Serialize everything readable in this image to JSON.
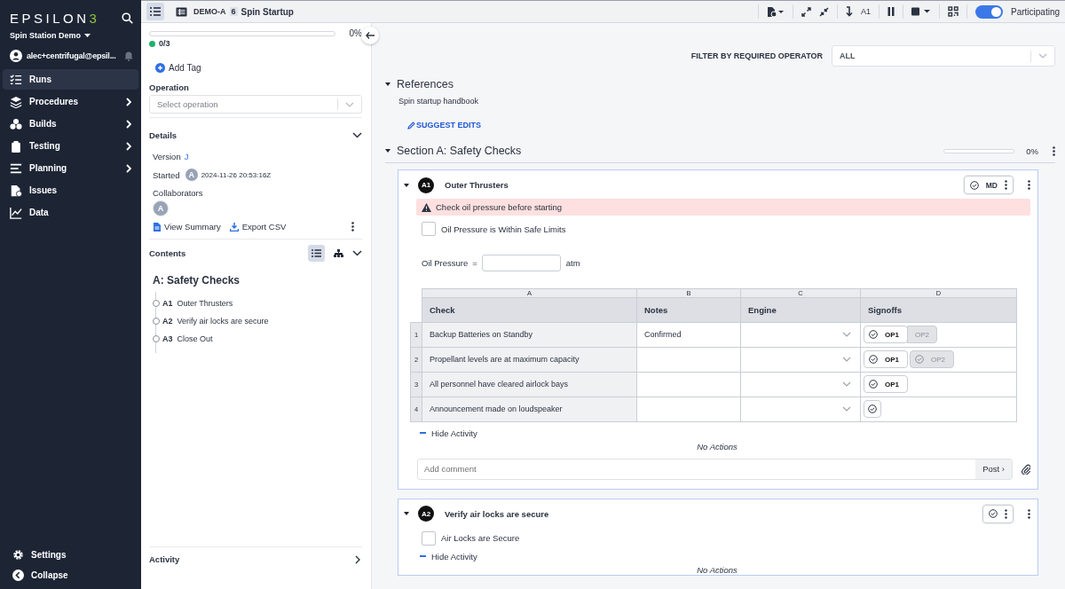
{
  "sidebar": {
    "logo": {
      "text": "EPSILON",
      "mark": "3"
    },
    "workspace": "Spin Station Demo",
    "user": "alec+centrifugal@epsil...",
    "items": [
      {
        "label": "Runs",
        "selected": true,
        "expandable": false
      },
      {
        "label": "Procedures",
        "selected": false,
        "expandable": true
      },
      {
        "label": "Builds",
        "selected": false,
        "expandable": true
      },
      {
        "label": "Testing",
        "selected": false,
        "expandable": true
      },
      {
        "label": "Planning",
        "selected": false,
        "expandable": true
      },
      {
        "label": "Issues",
        "selected": false,
        "expandable": false
      },
      {
        "label": "Data",
        "selected": false,
        "expandable": false
      }
    ],
    "footer": [
      {
        "label": "Settings"
      },
      {
        "label": "Collapse"
      }
    ]
  },
  "topbar": {
    "list_view": {
      "selected": true
    },
    "run_id": "DEMO-A",
    "badge": "6",
    "title": "Spin Startup",
    "jump_label": "A1",
    "participating": {
      "label": "Participating",
      "on": true
    }
  },
  "run_panel": {
    "progress": {
      "level": 0,
      "reading": "0%"
    },
    "count": "0/3",
    "add_tag": "Add Tag",
    "operation": {
      "label": "Operation",
      "placeholder": "Select operation"
    },
    "details": {
      "title": "Details",
      "version_label": "Version",
      "version": "J",
      "started_label": "Started",
      "started_avatar": "A",
      "started": "2024-11-26 20:53:16Z",
      "collaborators_label": "Collaborators",
      "collaborators": [
        "A"
      ],
      "links": [
        "View Summary",
        "Export CSV"
      ]
    },
    "contents": {
      "title": "Contents",
      "views": [
        {
          "selected": true
        },
        {
          "selected": false
        }
      ],
      "section": "A: Safety Checks",
      "items": [
        {
          "id": "A1",
          "label": "Outer Thrusters"
        },
        {
          "id": "A2",
          "label": "Verify air locks are secure"
        },
        {
          "id": "A3",
          "label": "Close Out"
        }
      ]
    },
    "activity": "Activity"
  },
  "main": {
    "filter": {
      "label": "FILTER BY REQUIRED OPERATOR",
      "value": "ALL"
    },
    "references": {
      "title": "References",
      "expanded": true,
      "text": "Spin startup handbook",
      "action": "SUGGEST EDITS"
    },
    "section": {
      "title": "Section A: Safety Checks",
      "expanded": true,
      "progress": {
        "level": 0,
        "reading": "0%"
      }
    },
    "steps": [
      {
        "id": "A1",
        "title": "Outer Thrusters",
        "operator": "MD",
        "alert": "Check oil pressure before starting",
        "checkbox": {
          "label": "Oil Pressure is Within Safe Limits",
          "checked": false
        },
        "field": {
          "label": "Oil Pressure",
          "equals": "=",
          "unit": "atm"
        },
        "table": {
          "letters": [
            "A",
            "B",
            "C",
            "D"
          ],
          "columns": [
            "Check",
            "Notes",
            "Engine",
            "Signoffs"
          ],
          "rows": [
            {
              "num": "1",
              "check": "Backup Batteries on Standby",
              "notes": "Confirmed",
              "signoffs": [
                {
                  "kind": "full",
                  "label": "OP1",
                  "disabled": false
                },
                {
                  "kind": "joined",
                  "label": "OP2",
                  "disabled": true
                }
              ]
            },
            {
              "num": "2",
              "check": "Propellant levels are at maximum capacity",
              "signoffs": [
                {
                  "kind": "full",
                  "label": "OP1",
                  "disabled": false
                },
                {
                  "kind": "full",
                  "label": "OP2",
                  "disabled": true
                }
              ]
            },
            {
              "num": "3",
              "check": "All personnel have cleared airlock bays",
              "signoffs": [
                {
                  "kind": "full",
                  "label": "OP1",
                  "disabled": false
                }
              ]
            },
            {
              "num": "4",
              "check": "Announcement made on loudspeaker",
              "signoffs": [
                {
                  "kind": "icon",
                  "disabled": false
                }
              ]
            }
          ]
        },
        "activity": "Hide Activity",
        "empty": "No Actions",
        "comment_placeholder": "Add comment",
        "post": "Post ›"
      },
      {
        "id": "A2",
        "title": "Verify air locks are secure",
        "checkbox": {
          "label": "Air Locks are Secure",
          "checked": false
        },
        "activity": "Hide Activity",
        "empty": "No Actions"
      }
    ]
  }
}
